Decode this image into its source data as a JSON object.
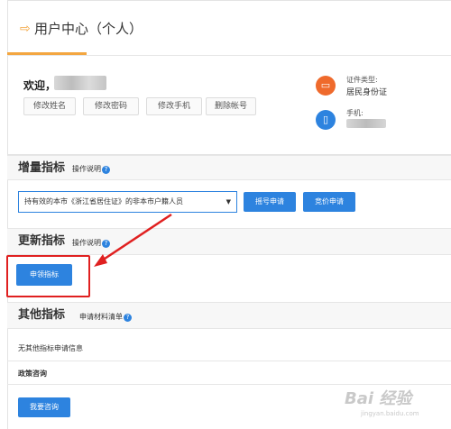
{
  "header": {
    "arrow": "⇨",
    "title": "用户中心（个人）"
  },
  "profile": {
    "welcome": "欢迎，",
    "buttons": [
      "修改姓名",
      "修改密码",
      "修改手机",
      "删除帐号"
    ],
    "id_type_label": "证件类型:",
    "id_type_value": "居民身份证",
    "phone_label": "手机:",
    "id_icon": "id-card-icon",
    "phone_icon": "phone-icon"
  },
  "increment": {
    "title": "增量指标",
    "help": "操作说明",
    "select_value": "持有效的本市《浙江省居住证》的非本市户籍人员",
    "lottery_button": "摇号申请",
    "bid_button": "竞价申请"
  },
  "renew": {
    "title": "更新指标",
    "help": "操作说明",
    "apply_button": "申领指标"
  },
  "other": {
    "title": "其他指标",
    "help": "申请材料清单",
    "empty_text": "无其他指标申请信息"
  },
  "policy": {
    "title": "政策咨询",
    "consult_button": "我要咨询"
  },
  "watermark": {
    "text": "Bai 经验",
    "sub": "jingyan.baidu.com"
  },
  "colors": {
    "accent": "#f3a640",
    "primary": "#2d83df",
    "highlight": "#e02020"
  }
}
